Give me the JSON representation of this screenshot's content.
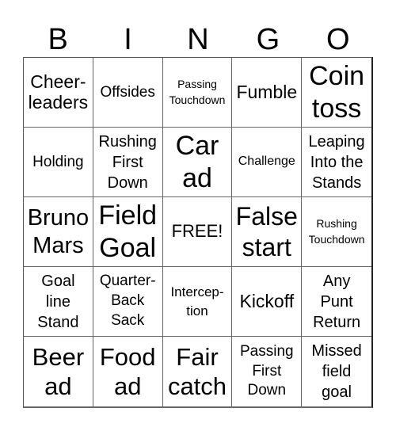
{
  "header": {
    "letters": [
      "B",
      "I",
      "N",
      "G",
      "O"
    ]
  },
  "board": {
    "rows": [
      [
        "Cheer-\nleaders",
        "Offsides",
        "Passing\nTouchdown",
        "Fumble",
        "Coin\ntoss"
      ],
      [
        "Holding",
        "Rushing\nFirst\nDown",
        "Car\nad",
        "Challenge",
        "Leaping\nInto the\nStands"
      ],
      [
        "Bruno\nMars",
        "Field\nGoal",
        "FREE!",
        "False\nstart",
        "Rushing\nTouchdown"
      ],
      [
        "Goal\nline\nStand",
        "Quarter-\nBack\nSack",
        "Intercep-\ntion",
        "Kickoff",
        "Any\nPunt\nReturn"
      ],
      [
        "Beer\nad",
        "Food\nad",
        "Fair\ncatch",
        "Passing\nFirst\nDown",
        "Missed\nfield\ngoal"
      ]
    ],
    "free_space": {
      "row": 2,
      "col": 2,
      "label": "FREE!"
    }
  },
  "colors": {
    "text": "#000000",
    "grid_line": "#666666",
    "background": "#ffffff"
  }
}
